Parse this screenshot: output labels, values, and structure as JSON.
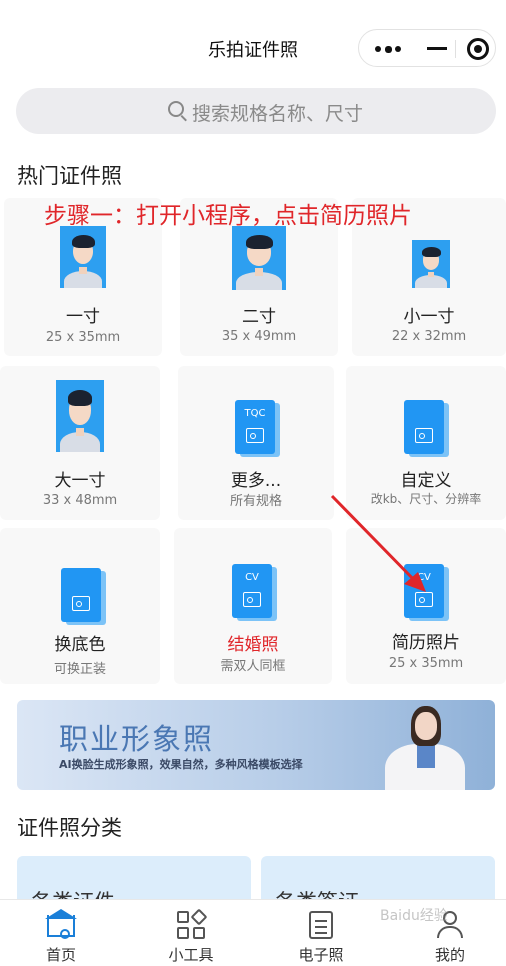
{
  "nav": {
    "title": "乐拍证件照"
  },
  "search": {
    "placeholder": "搜索规格名称、尺寸"
  },
  "hot": {
    "title": "热门证件照",
    "annotation": "步骤一：打开小程序，点击简历照片",
    "items": [
      {
        "name": "一寸",
        "sub": "25 x 35mm"
      },
      {
        "name": "二寸",
        "sub": "35 x 49mm"
      },
      {
        "name": "小一寸",
        "sub": "22 x 32mm"
      },
      {
        "name": "大一寸",
        "sub": "33 x 48mm"
      },
      {
        "name": "更多...",
        "sub": "所有规格",
        "icon_label": "TQC"
      },
      {
        "name": "自定义",
        "sub": "改kb、尺寸、分辨率"
      },
      {
        "name": "换底色",
        "sub": "可换正装"
      },
      {
        "name": "结婚照",
        "sub": "需双人同框",
        "icon_label": "CV"
      },
      {
        "name": "简历照片",
        "sub": "25 x 35mm",
        "icon_label": "CV"
      }
    ]
  },
  "banner": {
    "title": "职业形象照",
    "subtitle": "AI换脸生成形象照，效果自然，多种风格模板选择"
  },
  "categories": {
    "title": "证件照分类",
    "items": [
      "各类证件",
      "各类签证"
    ]
  },
  "tabbar": {
    "items": [
      "首页",
      "小工具",
      "电子照",
      "我的"
    ]
  },
  "watermark": "Baidu经验",
  "colors": {
    "accent": "#2196f3",
    "annotation": "#e0262a",
    "tab_active": "#1a7fd8"
  }
}
